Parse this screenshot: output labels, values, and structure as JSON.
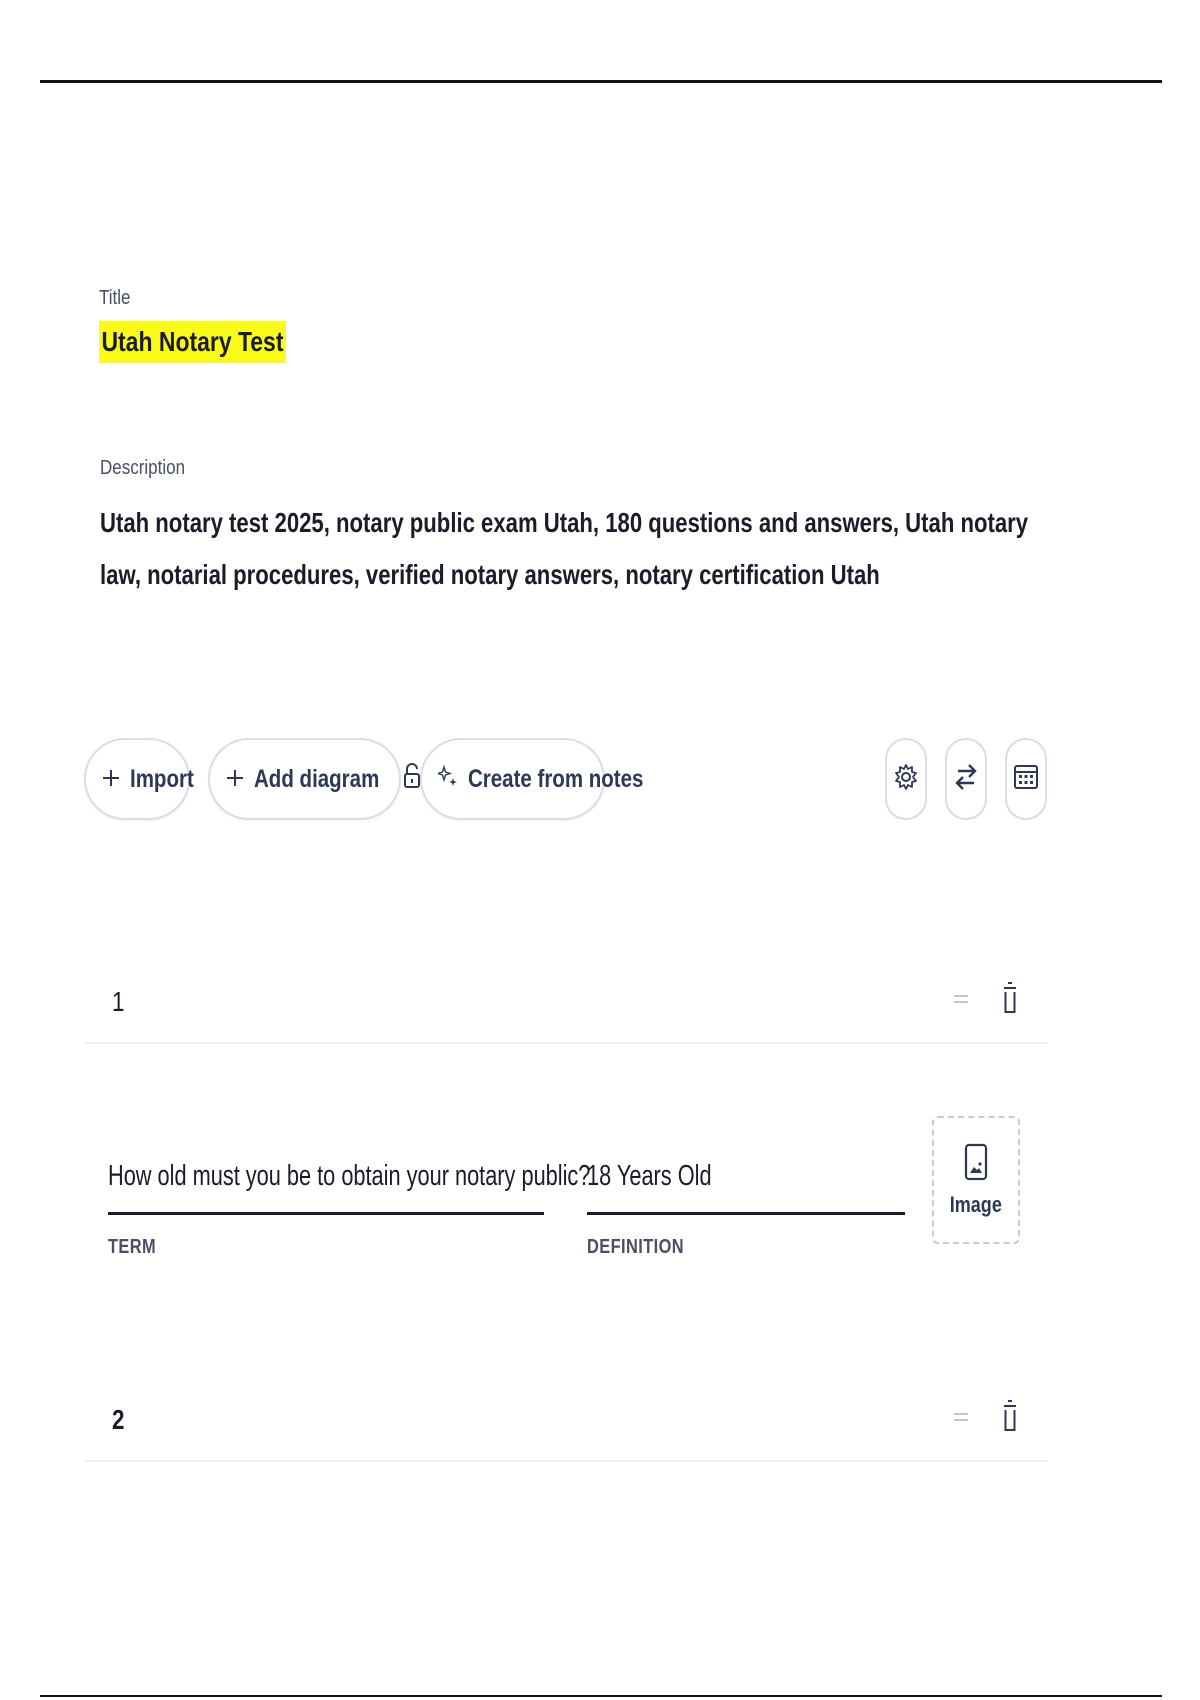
{
  "set": {
    "title_label": "Title",
    "title_value": "Utah  Notary Test",
    "description_label": "Description",
    "description_value": "Utah notary test 2025, notary public exam Utah, 180 questions and answers, Utah notary law, notarial procedures, verified notary answers, notary certification Utah"
  },
  "toolbar": {
    "import_label": "Import",
    "add_diagram_label": "Add diagram",
    "create_from_notes_label": "Create from notes",
    "icons": [
      "plus-icon",
      "lock-icon",
      "sparkle-icon",
      "gear-icon",
      "swap-icon",
      "keyboard-icon"
    ]
  },
  "cards": [
    {
      "number": "1",
      "term": "How old must you be to obtain your notary public?",
      "definition": "18 Years Old",
      "term_label": "TERM",
      "definition_label": "DEFINITION",
      "image_label": "Image"
    },
    {
      "number": "2"
    }
  ],
  "colors": {
    "highlight": "#fbfb1a",
    "text": "#1b1b2a",
    "button_text": "#2e3856",
    "border": "#dadce6"
  }
}
